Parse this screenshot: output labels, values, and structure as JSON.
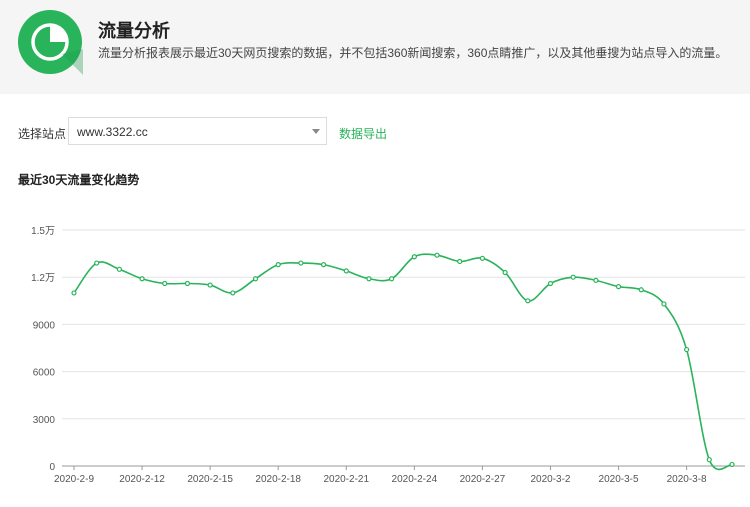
{
  "header": {
    "title": "流量分析",
    "description": "流量分析报表展示最近30天网页搜索的数据，并不包括360新闻搜索，360点睛推广，以及其他垂搜为站点导入的流量。",
    "logo_icon": "pie-chart-icon",
    "accent_color": "#29b35b"
  },
  "filter": {
    "site_label": "选择站点",
    "site_value": "www.3322.cc",
    "export_label": "数据导出"
  },
  "section": {
    "title": "最近30天流量变化趋势"
  },
  "chart_data": {
    "type": "line",
    "color": "#29b35b",
    "grid": true,
    "ylim": [
      0,
      15000
    ],
    "yticks": [
      0,
      3000,
      6000,
      9000,
      12000,
      15000
    ],
    "ytick_labels": [
      "0",
      "3000",
      "6000",
      "9000",
      "1.2万",
      "1.5万"
    ],
    "x": [
      "2020-2-9",
      "2020-2-10",
      "2020-2-11",
      "2020-2-12",
      "2020-2-13",
      "2020-2-14",
      "2020-2-15",
      "2020-2-16",
      "2020-2-17",
      "2020-2-18",
      "2020-2-19",
      "2020-2-20",
      "2020-2-21",
      "2020-2-22",
      "2020-2-23",
      "2020-2-24",
      "2020-2-25",
      "2020-2-26",
      "2020-2-27",
      "2020-2-28",
      "2020-2-29",
      "2020-3-1",
      "2020-3-2",
      "2020-3-3",
      "2020-3-4",
      "2020-3-5",
      "2020-3-6",
      "2020-3-7",
      "2020-3-8",
      "2020-3-9"
    ],
    "xtick_labels": [
      "2020-2-9",
      "2020-2-12",
      "2020-2-15",
      "2020-2-18",
      "2020-2-21",
      "2020-2-24",
      "2020-2-27",
      "2020-3-2",
      "2020-3-5",
      "2020-3-8"
    ],
    "xtick_index": [
      0,
      3,
      6,
      9,
      12,
      15,
      18,
      21,
      24,
      27
    ],
    "values": [
      11000,
      12900,
      12500,
      11900,
      11600,
      11600,
      11500,
      11000,
      11900,
      12800,
      12900,
      12800,
      12400,
      11900,
      11900,
      13300,
      13400,
      13000,
      13200,
      12300,
      10500,
      11600,
      12000,
      11800,
      11400,
      11200,
      10300,
      7400,
      400,
      100
    ]
  }
}
